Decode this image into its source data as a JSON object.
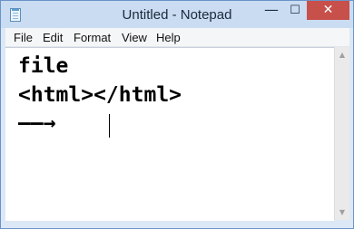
{
  "window": {
    "title": "Untitled - Notepad",
    "controls": {
      "minimize_glyph": "—",
      "maximize_glyph": "☐",
      "close_glyph": "✕"
    }
  },
  "menu": {
    "items": [
      {
        "label": "File"
      },
      {
        "label": "Edit"
      },
      {
        "label": "Format"
      },
      {
        "label": "View"
      },
      {
        "label": "Help"
      }
    ]
  },
  "editor": {
    "lines": [
      "file",
      "<html></html>",
      "——→"
    ]
  },
  "scrollbar": {
    "up_glyph": "▲",
    "down_glyph": "▼"
  },
  "colors": {
    "close_button": "#c7504a",
    "titlebar": "#c9dcf2",
    "menubar": "#f5f6f7"
  },
  "icons": [
    "notepad-app-icon",
    "minimize-icon",
    "maximize-icon",
    "close-icon",
    "scroll-up-arrow-icon",
    "scroll-down-arrow-icon"
  ]
}
